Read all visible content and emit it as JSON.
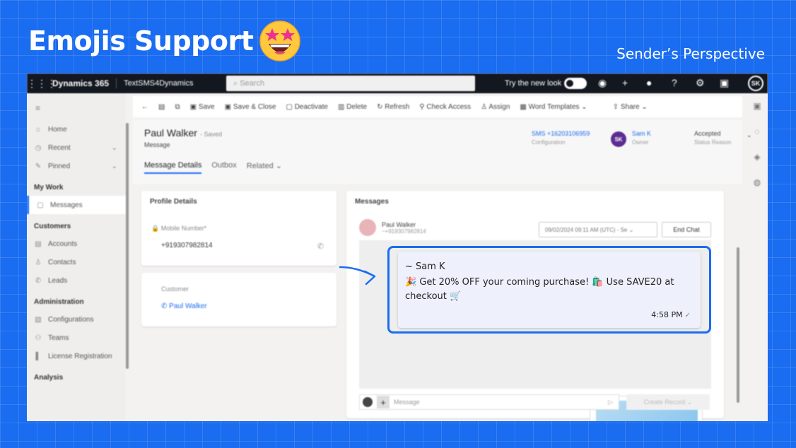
{
  "banner": {
    "title": "Emojis Support",
    "subtitle": "Sender’s Perspective"
  },
  "topbar": {
    "brand": "Dynamics 365",
    "app_name": "TextSMS4Dynamics",
    "search_placeholder": "Search",
    "try_new_look": "Try the new look",
    "user_initials": "SK"
  },
  "sidebar": {
    "items": [
      {
        "label": "Home",
        "icon": "home-icon"
      },
      {
        "label": "Recent",
        "icon": "clock-icon"
      },
      {
        "label": "Pinned",
        "icon": "pin-icon"
      }
    ],
    "my_work": {
      "title": "My Work",
      "items": [
        {
          "label": "Messages",
          "icon": "message-icon"
        }
      ]
    },
    "customers": {
      "title": "Customers",
      "items": [
        {
          "label": "Accounts",
          "icon": "building-icon"
        },
        {
          "label": "Contacts",
          "icon": "person-icon"
        },
        {
          "label": "Leads",
          "icon": "phone-icon"
        }
      ]
    },
    "administration": {
      "title": "Administration",
      "items": [
        {
          "label": "Configurations",
          "icon": "config-icon"
        },
        {
          "label": "Teams",
          "icon": "team-icon"
        },
        {
          "label": "License Registration",
          "icon": "license-icon"
        }
      ]
    },
    "analysis": {
      "title": "Analysis"
    }
  },
  "commandbar": {
    "save": "Save",
    "save_close": "Save & Close",
    "deactivate": "Deactivate",
    "delete": "Delete",
    "refresh": "Refresh",
    "check_access": "Check Access",
    "assign": "Assign",
    "word_templates": "Word Templates",
    "share": "Share"
  },
  "record": {
    "title": "Paul Walker",
    "saved": "- Saved",
    "entity": "Message",
    "sms_field": "SMS +16203106959",
    "sms_label": "Configuration",
    "owner_initials": "SK",
    "owner_name": "Sam K",
    "owner_label": "Owner",
    "status": "Accepted",
    "status_label": "Status Reason",
    "tabs": [
      "Message Details",
      "Outbox",
      "Related"
    ]
  },
  "profile": {
    "title": "Profile Details",
    "mobile_label": "Mobile Number",
    "mobile_value": "+919307982814"
  },
  "customer": {
    "label": "Customer",
    "value": "Paul Walker"
  },
  "messages": {
    "title": "Messages",
    "contact_name": "Paul Walker",
    "contact_phone": "+919307982814",
    "date_selector": "09/02/2024 09:11 AM (UTC) - Se",
    "end_chat": "End Chat",
    "composer_placeholder": "Message",
    "create_record": "Create Record"
  },
  "bubble": {
    "sender": "~ Sam K",
    "body": "🎉 Get 20% OFF your coming purchase! 🛍️ Use SAVE20 at checkout 🛒",
    "time": "4:58 PM",
    "tick": "✓"
  },
  "colors": {
    "background": "#1a6cf0",
    "highlight": "#1a6cf0",
    "bubble_bg": "#eef0fb"
  }
}
